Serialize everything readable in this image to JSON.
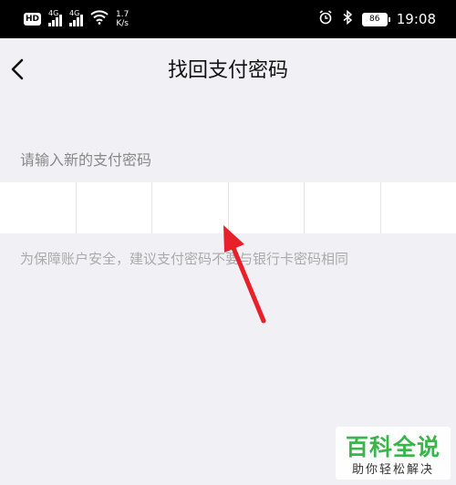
{
  "status_bar": {
    "hd_label": "HD",
    "network1": "4G",
    "network2": "4G",
    "speed_value": "1.7",
    "speed_unit": "K/s",
    "battery": "86",
    "time": "19:08"
  },
  "header": {
    "title": "找回支付密码"
  },
  "form": {
    "prompt": "请输入新的支付密码",
    "pin_length": 6,
    "hint": "为保障账户安全，建议支付密码不要与银行卡密码相同"
  },
  "watermark": {
    "main": "百科全说",
    "sub": "助你轻松解决"
  },
  "colors": {
    "background": "#f1f0f5",
    "arrow": "#e8202a",
    "watermark_green": "#39b54a"
  }
}
